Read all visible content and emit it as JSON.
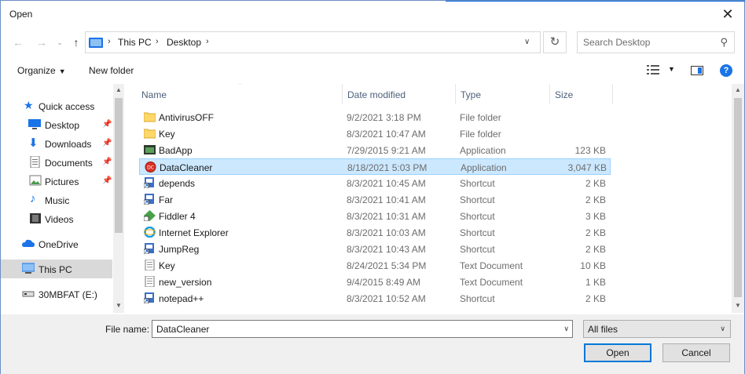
{
  "window": {
    "title": "Open"
  },
  "address": {
    "segments": [
      "This PC",
      "Desktop"
    ]
  },
  "search": {
    "placeholder": "Search Desktop"
  },
  "toolbar": {
    "organize_label": "Organize",
    "new_folder_label": "New folder"
  },
  "sidebar": {
    "items": [
      {
        "label": "Quick access",
        "icon": "star-icon"
      },
      {
        "label": "Desktop",
        "icon": "desktop-icon",
        "pinned": true
      },
      {
        "label": "Downloads",
        "icon": "download-icon",
        "pinned": true
      },
      {
        "label": "Documents",
        "icon": "documents-icon",
        "pinned": true
      },
      {
        "label": "Pictures",
        "icon": "pictures-icon",
        "pinned": true
      },
      {
        "label": "Music",
        "icon": "music-icon"
      },
      {
        "label": "Videos",
        "icon": "videos-icon"
      },
      {
        "label": "OneDrive",
        "icon": "cloud-icon"
      },
      {
        "label": "This PC",
        "icon": "computer-icon",
        "selected": true
      },
      {
        "label": "30MBFAT (E:)",
        "icon": "drive-icon"
      }
    ]
  },
  "columns": {
    "name": "Name",
    "date": "Date modified",
    "type": "Type",
    "size": "Size"
  },
  "files": [
    {
      "name": "AntivirusOFF",
      "date": "9/2/2021 3:18 PM",
      "type": "File folder",
      "size": "",
      "icon": "folder-icon"
    },
    {
      "name": "Key",
      "date": "8/3/2021 10:47 AM",
      "type": "File folder",
      "size": "",
      "icon": "folder-icon"
    },
    {
      "name": "BadApp",
      "date": "7/29/2015 9:21 AM",
      "type": "Application",
      "size": "123 KB",
      "icon": "app-icon"
    },
    {
      "name": "DataCleaner",
      "date": "8/18/2021 5:03 PM",
      "type": "Application",
      "size": "3,047 KB",
      "icon": "datacleaner-icon",
      "selected": true
    },
    {
      "name": "depends",
      "date": "8/3/2021 10:45 AM",
      "type": "Shortcut",
      "size": "2 KB",
      "icon": "shortcut-icon"
    },
    {
      "name": "Far",
      "date": "8/3/2021 10:41 AM",
      "type": "Shortcut",
      "size": "2 KB",
      "icon": "shortcut-icon"
    },
    {
      "name": "Fiddler 4",
      "date": "8/3/2021 10:31 AM",
      "type": "Shortcut",
      "size": "3 KB",
      "icon": "fiddler-icon"
    },
    {
      "name": "Internet Explorer",
      "date": "8/3/2021 10:03 AM",
      "type": "Shortcut",
      "size": "2 KB",
      "icon": "ie-icon"
    },
    {
      "name": "JumpReg",
      "date": "8/3/2021 10:43 AM",
      "type": "Shortcut",
      "size": "2 KB",
      "icon": "shortcut-icon"
    },
    {
      "name": "Key",
      "date": "8/24/2021 5:34 PM",
      "type": "Text Document",
      "size": "10 KB",
      "icon": "text-file-icon"
    },
    {
      "name": "new_version",
      "date": "9/4/2015 8:49 AM",
      "type": "Text Document",
      "size": "1 KB",
      "icon": "text-file-icon"
    },
    {
      "name": "notepad++",
      "date": "8/3/2021 10:52 AM",
      "type": "Shortcut",
      "size": "2 KB",
      "icon": "shortcut-icon"
    }
  ],
  "bottom": {
    "file_name_label": "File name:",
    "file_name_value": "DataCleaner",
    "filter_value": "All files",
    "open_label": "Open",
    "cancel_label": "Cancel"
  },
  "colors": {
    "accent": "#0078d7",
    "selection": "#cce8ff",
    "folder": "#ffd86b"
  }
}
